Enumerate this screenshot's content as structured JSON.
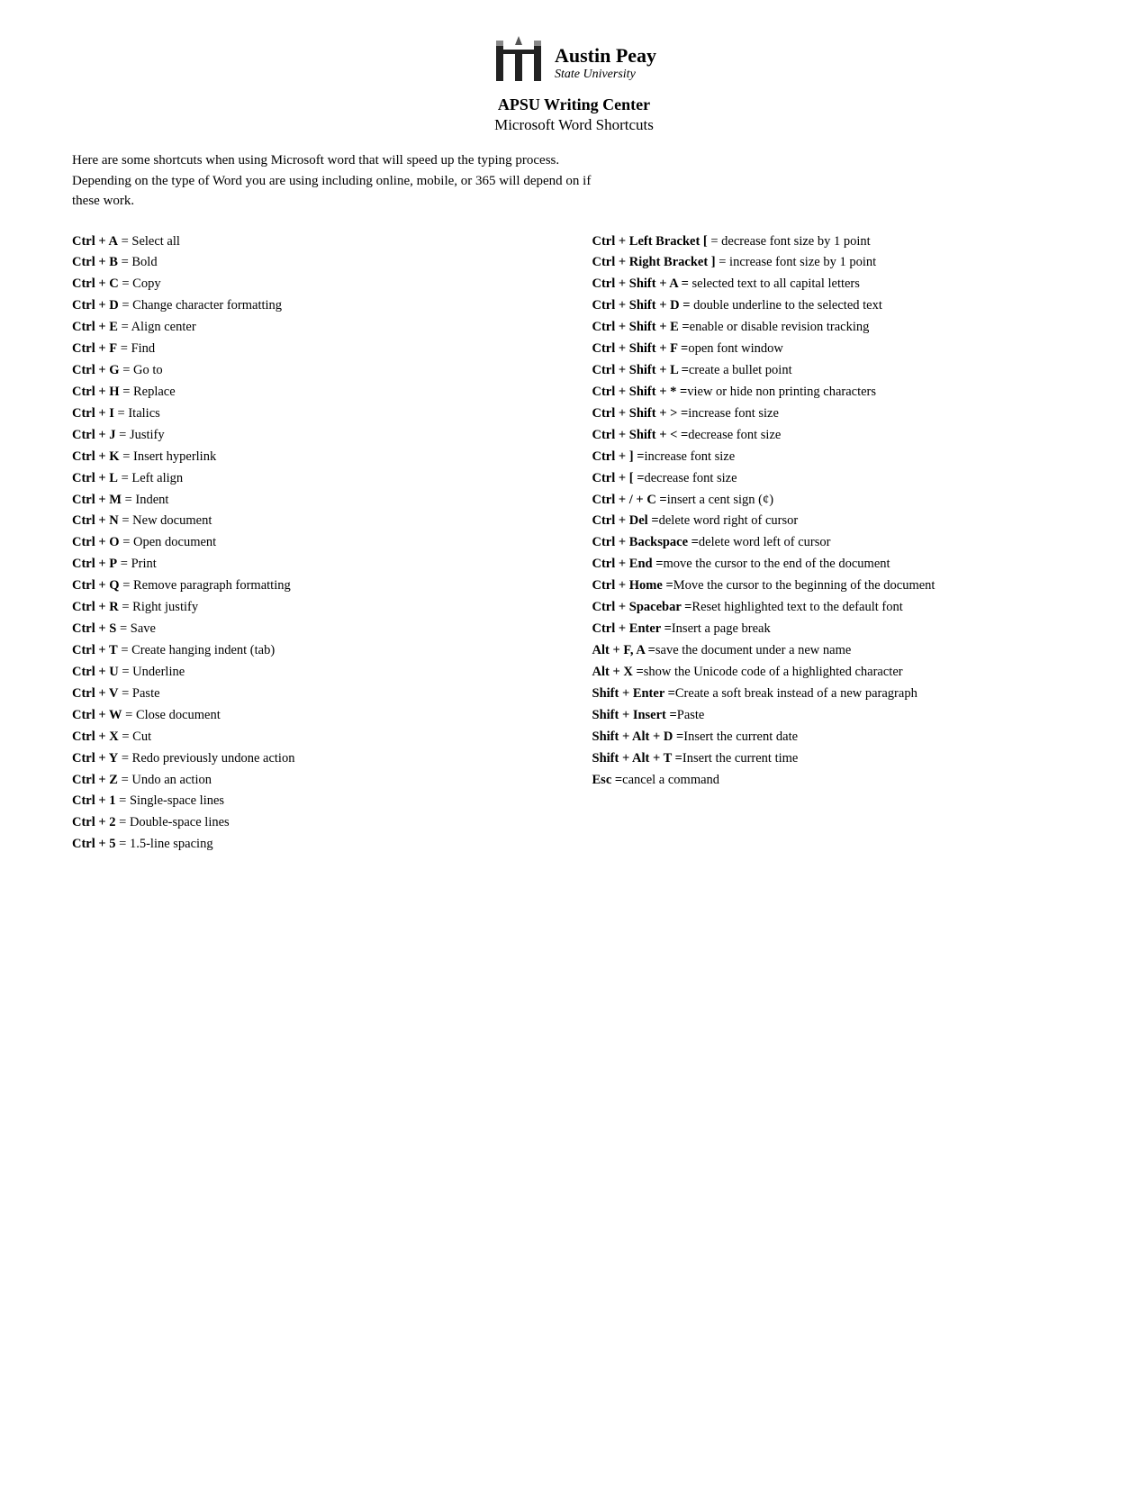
{
  "header": {
    "logo_line1": "Austin Peay",
    "logo_line2": "State University",
    "center_title": "APSU Writing Center",
    "doc_title": "Microsoft Word Shortcuts"
  },
  "intro": {
    "line1": "Here are some shortcuts when using Microsoft word that will speed up the typing process.",
    "line2": "Depending on the type of Word you are using including online, mobile, or 365 will depend on if",
    "line3": "these work."
  },
  "left_shortcuts": [
    {
      "key": "Ctrl + A",
      "desc": "Select all"
    },
    {
      "key": "Ctrl + B",
      "desc": "Bold"
    },
    {
      "key": "Ctrl + C",
      "desc": "Copy"
    },
    {
      "key": "Ctrl + D",
      "desc": "Change character formatting"
    },
    {
      "key": "Ctrl + E",
      "desc": "Align center"
    },
    {
      "key": "Ctrl + F",
      "desc": "Find"
    },
    {
      "key": "Ctrl + G",
      "desc": "Go to"
    },
    {
      "key": "Ctrl + H",
      "desc": "Replace"
    },
    {
      "key": "Ctrl + I",
      "desc": "Italics"
    },
    {
      "key": "Ctrl + J",
      "desc": "Justify"
    },
    {
      "key": "Ctrl + K",
      "desc": "Insert hyperlink"
    },
    {
      "key": "Ctrl + L",
      "desc": "Left align"
    },
    {
      "key": "Ctrl + M",
      "desc": "Indent"
    },
    {
      "key": "Ctrl + N",
      "desc": "New document"
    },
    {
      "key": "Ctrl + O",
      "desc": "Open document"
    },
    {
      "key": "Ctrl + P",
      "desc": "Print"
    },
    {
      "key": "Ctrl + Q",
      "desc": "Remove paragraph formatting"
    },
    {
      "key": "Ctrl + R",
      "desc": "Right justify"
    },
    {
      "key": "Ctrl + S",
      "desc": "Save"
    },
    {
      "key": "Ctrl + T",
      "desc": "Create hanging indent (tab)"
    },
    {
      "key": "Ctrl + U",
      "desc": "Underline"
    },
    {
      "key": "Ctrl + V",
      "desc": "Paste"
    },
    {
      "key": "Ctrl + W",
      "desc": "Close document"
    },
    {
      "key": "Ctrl + X",
      "desc": "Cut"
    },
    {
      "key": "Ctrl + Y",
      "desc": "Redo previously undone action"
    },
    {
      "key": "Ctrl + Z",
      "desc": "Undo an action"
    },
    {
      "key": "Ctrl + 1",
      "desc": "Single-space lines"
    },
    {
      "key": "Ctrl + 2",
      "desc": "Double-space lines"
    },
    {
      "key": "Ctrl + 5",
      "desc": "1.5-line spacing"
    }
  ],
  "right_shortcuts": [
    {
      "key": "Ctrl + Left Bracket [",
      "desc": "decrease font size by 1 point"
    },
    {
      "key": "Ctrl + Right Bracket ]",
      "desc": "increase font size by 1 point"
    },
    {
      "key": "Ctrl + Shift + A =",
      "desc": " selected text to all capital letters"
    },
    {
      "key": "Ctrl + Shift + D =",
      "desc": " double underline to the selected text"
    },
    {
      "key": "Ctrl + Shift + E =",
      "desc": "enable or disable revision tracking"
    },
    {
      "key": "Ctrl + Shift + F =",
      "desc": "open font window"
    },
    {
      "key": "Ctrl + Shift + L =",
      "desc": "create a bullet point"
    },
    {
      "key": "Ctrl + Shift + * =",
      "desc": "view or hide non printing characters"
    },
    {
      "key": "Ctrl + Shift + > =",
      "desc": "increase font size"
    },
    {
      "key": "Ctrl + Shift + < =",
      "desc": "decrease font size"
    },
    {
      "key": "Ctrl + ] =",
      "desc": "increase font size"
    },
    {
      "key": "Ctrl + [ =",
      "desc": "decrease font size"
    },
    {
      "key": "Ctrl + / + C =",
      "desc": "insert a cent sign (¢)"
    },
    {
      "key": "Ctrl + Del =",
      "desc": "delete word right of cursor"
    },
    {
      "key": "Ctrl + Backspace =",
      "desc": "delete word left of cursor"
    },
    {
      "key": "Ctrl + End =",
      "desc": "move the cursor to the end of the document"
    },
    {
      "key": "Ctrl + Home =",
      "desc": "Move the cursor to the beginning of the document"
    },
    {
      "key": "Ctrl + Spacebar =",
      "desc": "Reset highlighted text to the default font"
    },
    {
      "key": "Ctrl + Enter =",
      "desc": "Insert a page break"
    },
    {
      "key": "Alt + F, A =",
      "desc": "save the document under a new name"
    },
    {
      "key": "Alt + X =",
      "desc": "show the Unicode code of a highlighted character"
    },
    {
      "key": "Shift + Enter =",
      "desc": "Create a soft break instead of a new paragraph"
    },
    {
      "key": "Shift + Insert =",
      "desc": "Paste"
    },
    {
      "key": "Shift + Alt + D =",
      "desc": "Insert the current date"
    },
    {
      "key": "Shift + Alt + T =",
      "desc": "Insert the current time"
    },
    {
      "key": "Esc =",
      "desc": "cancel a command"
    }
  ]
}
